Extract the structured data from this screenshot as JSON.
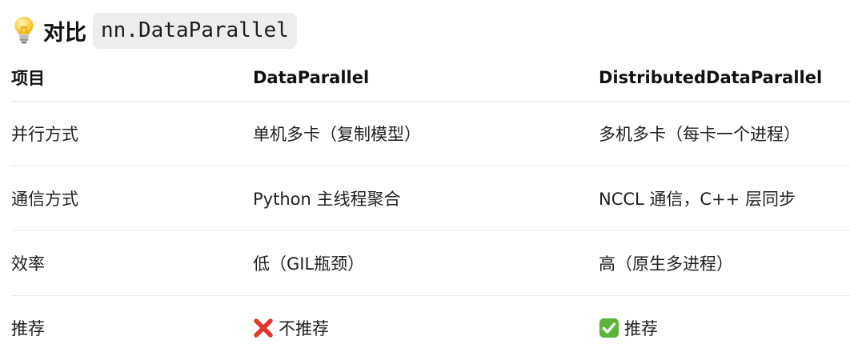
{
  "heading": {
    "icon": "lightbulb-icon",
    "text": "对比",
    "code": "nn.DataParallel"
  },
  "table": {
    "headers": [
      "项目",
      "DataParallel",
      "DistributedDataParallel"
    ],
    "rows": [
      {
        "item": "并行方式",
        "dp": "单机多卡（复制模型）",
        "ddp": "多机多卡（每卡一个进程）"
      },
      {
        "item": "通信方式",
        "dp": "Python 主线程聚合",
        "ddp": "NCCL 通信，C++ 层同步"
      },
      {
        "item": "效率",
        "dp": "低（GIL瓶颈）",
        "ddp": "高（原生多进程）"
      },
      {
        "item": "推荐",
        "dp": "不推荐",
        "dp_icon": "cross-mark-icon",
        "ddp": "推荐",
        "ddp_icon": "check-mark-icon"
      }
    ]
  },
  "colors": {
    "cross": "#e0362c",
    "check": "#5bb43c",
    "code_bg": "#ededed"
  }
}
